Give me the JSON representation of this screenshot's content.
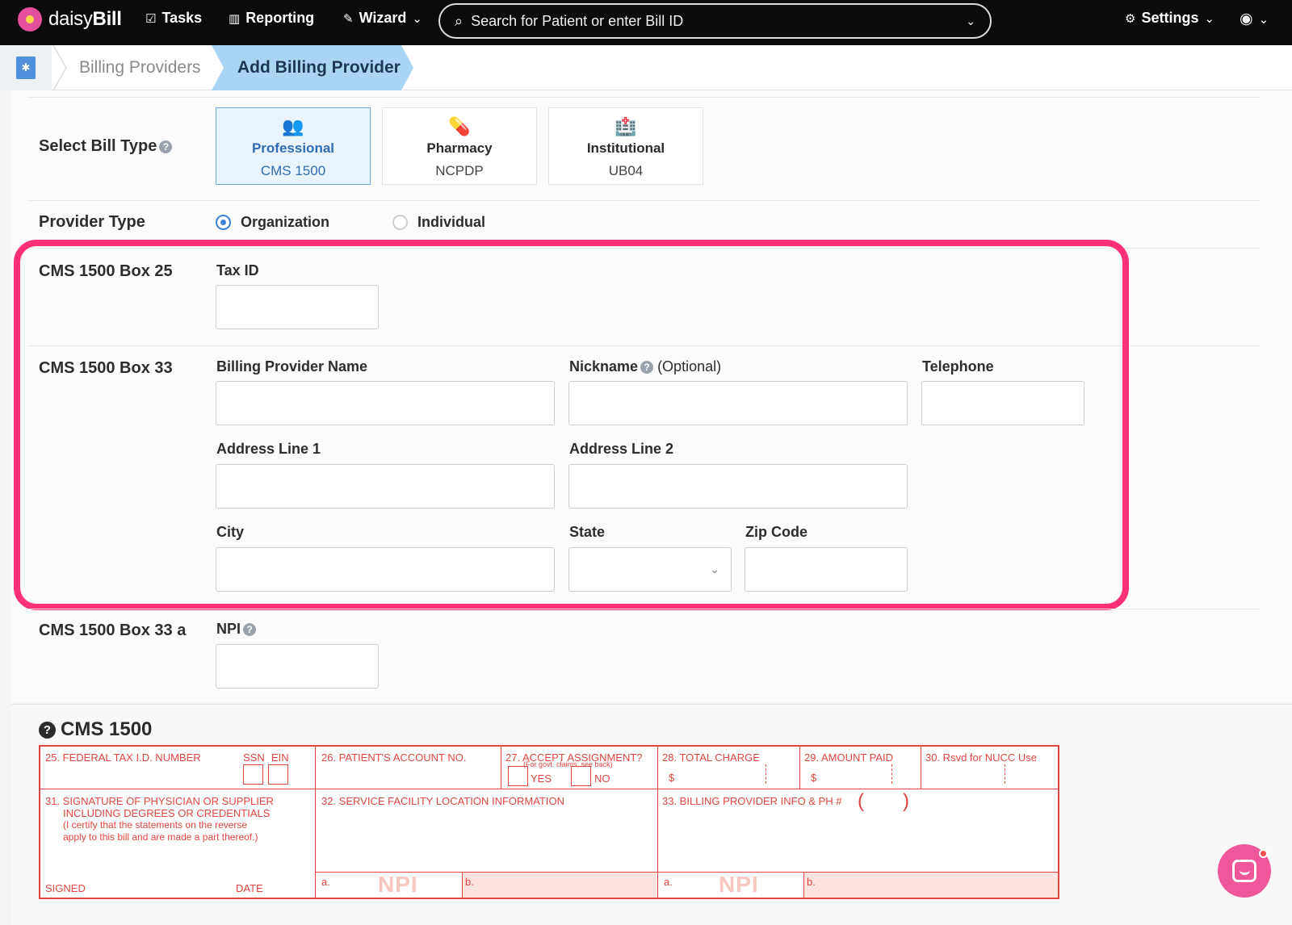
{
  "nav": {
    "logo_prefix": "daisy",
    "logo_suffix": "Bill",
    "tasks": "Tasks",
    "reporting": "Reporting",
    "wizard": "Wizard",
    "search_placeholder": "Search for Patient or enter Bill ID",
    "settings": "Settings"
  },
  "breadcrumb": {
    "parent": "Billing Providers",
    "current": "Add Billing Provider"
  },
  "bill_type": {
    "label": "Select Bill Type",
    "options": [
      {
        "title": "Professional",
        "sub": "CMS 1500",
        "selected": true,
        "icon": "users-icon"
      },
      {
        "title": "Pharmacy",
        "sub": "NCPDP",
        "selected": false,
        "icon": "pill-icon"
      },
      {
        "title": "Institutional",
        "sub": "UB04",
        "selected": false,
        "icon": "hospital-icon"
      }
    ]
  },
  "provider_type": {
    "label": "Provider Type",
    "organization": "Organization",
    "individual": "Individual",
    "selected": "Organization"
  },
  "box25": {
    "label": "CMS 1500 Box 25",
    "tax_id_label": "Tax ID",
    "tax_id_value": ""
  },
  "box33": {
    "label": "CMS 1500 Box 33",
    "billing_provider_name": "Billing Provider Name",
    "nickname": "Nickname",
    "optional": "(Optional)",
    "telephone": "Telephone",
    "address1": "Address Line 1",
    "address2": "Address Line 2",
    "city": "City",
    "state": "State",
    "zip": "Zip Code"
  },
  "box33a": {
    "label": "CMS 1500 Box 33 a",
    "npi_label": "NPI"
  },
  "cms_form": {
    "title": "CMS 1500",
    "f25": "25. FEDERAL TAX I.D. NUMBER",
    "ssn": "SSN",
    "ein": "EIN",
    "f26": "26. PATIENT'S ACCOUNT NO.",
    "f27": "27. ACCEPT ASSIGNMENT?",
    "f27_note": "(For govt. claims, see back)",
    "yes": "YES",
    "no": "NO",
    "f28": "28. TOTAL CHARGE",
    "f29": "29. AMOUNT PAID",
    "f30": "30. Rsvd for NUCC Use",
    "dollar": "$",
    "f31_line1": "31. SIGNATURE OF PHYSICIAN OR SUPPLIER",
    "f31_line2": "INCLUDING DEGREES OR CREDENTIALS",
    "f31_line3": "(I certify that the statements on the reverse",
    "f31_line4": "apply to this bill and are made a part thereof.)",
    "signed": "SIGNED",
    "date": "DATE",
    "f32": "32. SERVICE FACILITY LOCATION INFORMATION",
    "f33": "33. BILLING PROVIDER INFO & PH #",
    "paren_open": "(",
    "paren_close": ")",
    "a": "a.",
    "b": "b.",
    "npi_watermark": "NPI"
  },
  "colors": {
    "highlight": "#ff2f7a",
    "accent": "#3b82d6",
    "form_red": "#e0463f"
  }
}
